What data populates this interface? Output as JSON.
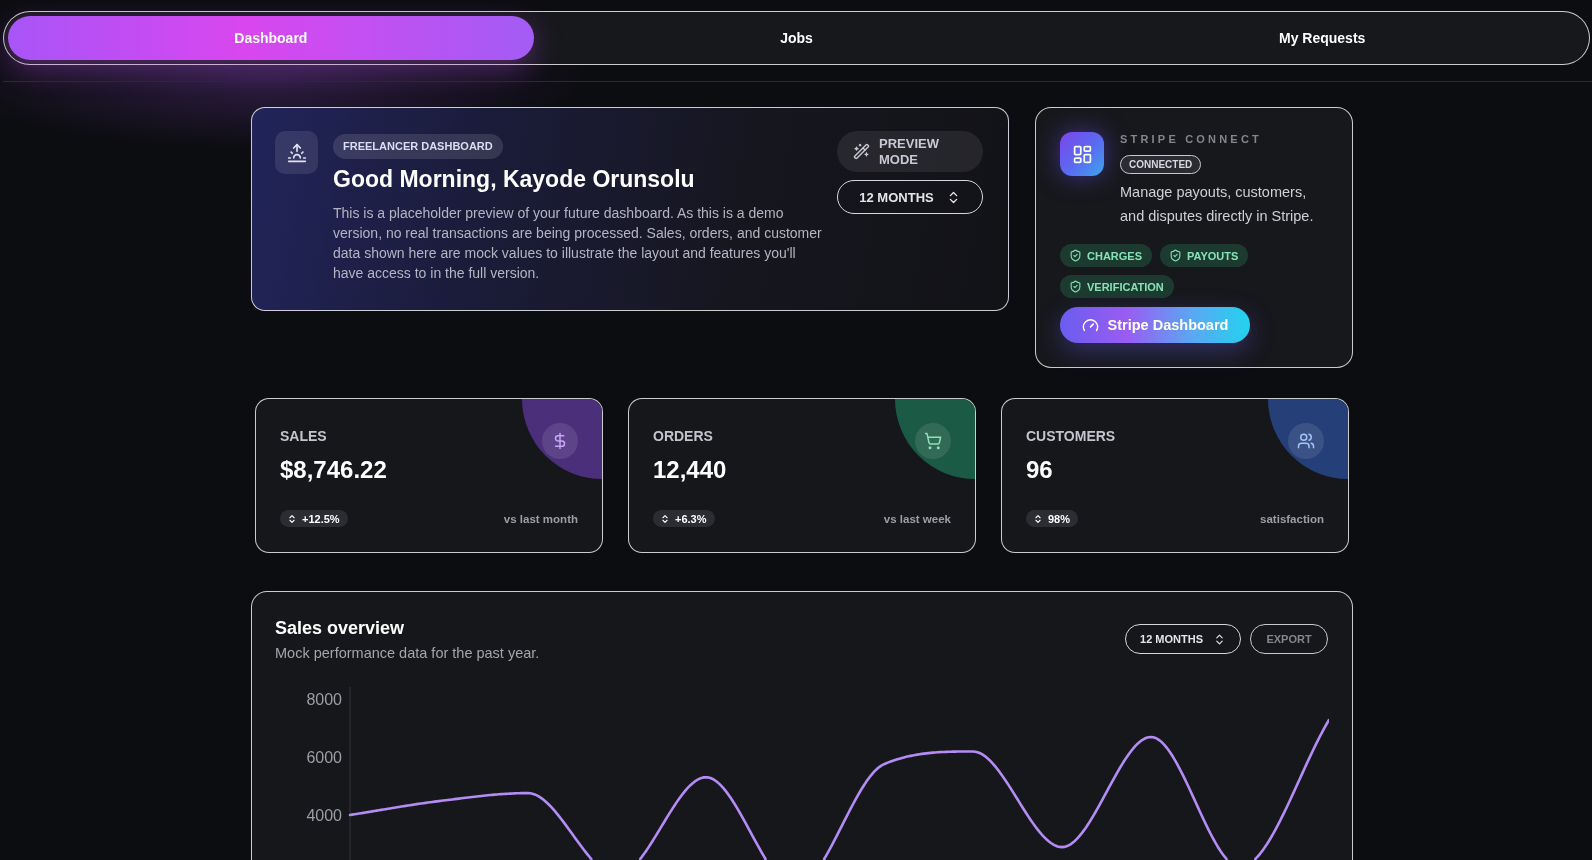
{
  "nav": {
    "tabs": [
      {
        "label": "Dashboard",
        "selected": true
      },
      {
        "label": "Jobs",
        "selected": false
      },
      {
        "label": "My Requests",
        "selected": false
      }
    ]
  },
  "hero": {
    "badge": "FREELANCER DASHBOARD",
    "title": "Good Morning, Kayode Orunsolu",
    "description": "This is a placeholder preview of your future dashboard. As this is a demo version, no real transactions are being processed. Sales, orders, and customer data shown here are mock values to illustrate the layout and features you'll have access to in the full version.",
    "preview_button": "PREVIEW MODE",
    "period_select": "12 MONTHS"
  },
  "stripe": {
    "eyebrow": "STRIPE CONNECT",
    "status": "CONNECTED",
    "description": "Manage payouts, customers, and disputes directly in Stripe.",
    "capabilities": [
      "CHARGES",
      "PAYOUTS",
      "VERIFICATION"
    ],
    "button": "Stripe Dashboard"
  },
  "stats": [
    {
      "kind": "sales",
      "label": "SALES",
      "value": "$8,746.22",
      "change": "+12.5%",
      "note": "vs last month",
      "color": "#4b2f7b"
    },
    {
      "kind": "orders",
      "label": "ORDERS",
      "value": "12,440",
      "change": "+6.3%",
      "note": "vs last week",
      "color": "#1b5a45"
    },
    {
      "kind": "customers",
      "label": "CUSTOMERS",
      "value": "96",
      "change": "98%",
      "note": "satisfaction",
      "color": "#253f79"
    }
  ],
  "sales_overview": {
    "title": "Sales overview",
    "subtitle": "Mock performance data for the past year.",
    "period_select": "12 MONTHS",
    "export_button": {
      "label": "EXPORT",
      "disabled": true
    },
    "y_axis_labels": [
      "8000",
      "6000",
      "4000"
    ]
  }
}
